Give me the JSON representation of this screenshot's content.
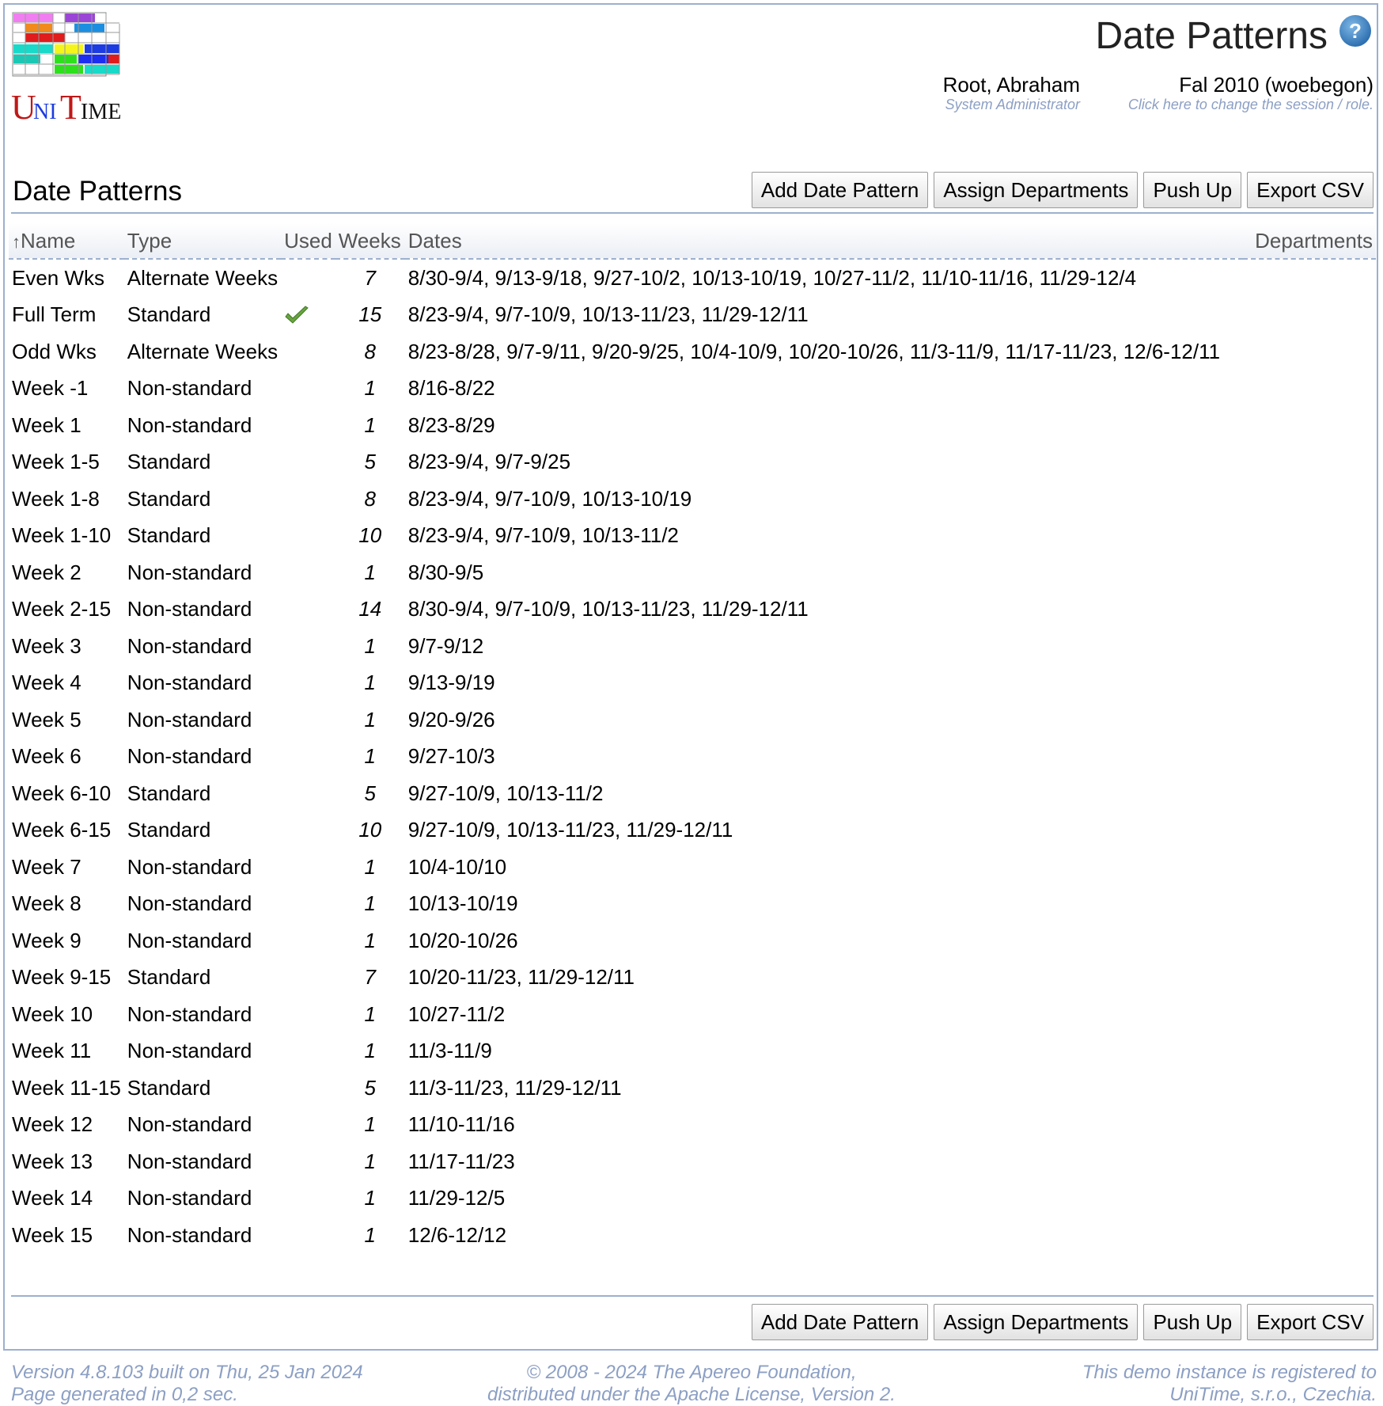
{
  "header": {
    "page_title": "Date Patterns",
    "user_name": "Root, Abraham",
    "user_role": "System Administrator",
    "session_name": "Fal 2010 (woebegon)",
    "session_hint": "Click here to change the session / role."
  },
  "logo": {
    "text_u": "U",
    "text_ni": "NI",
    "text_t": "T",
    "text_ime": "IME"
  },
  "section": {
    "title": "Date Patterns",
    "buttons": {
      "add": "Add Date Pattern",
      "assign": "Assign Departments",
      "push": "Push Up",
      "export": "Export CSV"
    }
  },
  "table": {
    "columns": {
      "sort_arrow": "↑",
      "name": "Name",
      "type": "Type",
      "used": "Used",
      "weeks": "Weeks",
      "dates": "Dates",
      "departments": "Departments"
    },
    "rows": [
      {
        "name": "Even Wks",
        "type": "Alternate Weeks",
        "used": false,
        "weeks": "7",
        "dates": "8/30-9/4, 9/13-9/18, 9/27-10/2, 10/13-10/19, 10/27-11/2, 11/10-11/16, 11/29-12/4",
        "departments": ""
      },
      {
        "name": "Full Term",
        "type": "Standard",
        "used": true,
        "weeks": "15",
        "dates": "8/23-9/4, 9/7-10/9, 10/13-11/23, 11/29-12/11",
        "departments": ""
      },
      {
        "name": "Odd Wks",
        "type": "Alternate Weeks",
        "used": false,
        "weeks": "8",
        "dates": "8/23-8/28, 9/7-9/11, 9/20-9/25, 10/4-10/9, 10/20-10/26, 11/3-11/9, 11/17-11/23, 12/6-12/11",
        "departments": ""
      },
      {
        "name": "Week -1",
        "type": "Non-standard",
        "used": false,
        "weeks": "1",
        "dates": "8/16-8/22",
        "departments": ""
      },
      {
        "name": "Week 1",
        "type": "Non-standard",
        "used": false,
        "weeks": "1",
        "dates": "8/23-8/29",
        "departments": ""
      },
      {
        "name": "Week 1-5",
        "type": "Standard",
        "used": false,
        "weeks": "5",
        "dates": "8/23-9/4, 9/7-9/25",
        "departments": ""
      },
      {
        "name": "Week 1-8",
        "type": "Standard",
        "used": false,
        "weeks": "8",
        "dates": "8/23-9/4, 9/7-10/9, 10/13-10/19",
        "departments": ""
      },
      {
        "name": "Week 1-10",
        "type": "Standard",
        "used": false,
        "weeks": "10",
        "dates": "8/23-9/4, 9/7-10/9, 10/13-11/2",
        "departments": ""
      },
      {
        "name": "Week 2",
        "type": "Non-standard",
        "used": false,
        "weeks": "1",
        "dates": "8/30-9/5",
        "departments": ""
      },
      {
        "name": "Week 2-15",
        "type": "Non-standard",
        "used": false,
        "weeks": "14",
        "dates": "8/30-9/4, 9/7-10/9, 10/13-11/23, 11/29-12/11",
        "departments": ""
      },
      {
        "name": "Week 3",
        "type": "Non-standard",
        "used": false,
        "weeks": "1",
        "dates": "9/7-9/12",
        "departments": ""
      },
      {
        "name": "Week 4",
        "type": "Non-standard",
        "used": false,
        "weeks": "1",
        "dates": "9/13-9/19",
        "departments": ""
      },
      {
        "name": "Week 5",
        "type": "Non-standard",
        "used": false,
        "weeks": "1",
        "dates": "9/20-9/26",
        "departments": ""
      },
      {
        "name": "Week 6",
        "type": "Non-standard",
        "used": false,
        "weeks": "1",
        "dates": "9/27-10/3",
        "departments": ""
      },
      {
        "name": "Week 6-10",
        "type": "Standard",
        "used": false,
        "weeks": "5",
        "dates": "9/27-10/9, 10/13-11/2",
        "departments": ""
      },
      {
        "name": "Week 6-15",
        "type": "Standard",
        "used": false,
        "weeks": "10",
        "dates": "9/27-10/9, 10/13-11/23, 11/29-12/11",
        "departments": ""
      },
      {
        "name": "Week 7",
        "type": "Non-standard",
        "used": false,
        "weeks": "1",
        "dates": "10/4-10/10",
        "departments": ""
      },
      {
        "name": "Week 8",
        "type": "Non-standard",
        "used": false,
        "weeks": "1",
        "dates": "10/13-10/19",
        "departments": ""
      },
      {
        "name": "Week 9",
        "type": "Non-standard",
        "used": false,
        "weeks": "1",
        "dates": "10/20-10/26",
        "departments": ""
      },
      {
        "name": "Week 9-15",
        "type": "Standard",
        "used": false,
        "weeks": "7",
        "dates": "10/20-11/23, 11/29-12/11",
        "departments": ""
      },
      {
        "name": "Week 10",
        "type": "Non-standard",
        "used": false,
        "weeks": "1",
        "dates": "10/27-11/2",
        "departments": ""
      },
      {
        "name": "Week 11",
        "type": "Non-standard",
        "used": false,
        "weeks": "1",
        "dates": "11/3-11/9",
        "departments": ""
      },
      {
        "name": "Week 11-15",
        "type": "Standard",
        "used": false,
        "weeks": "5",
        "dates": "11/3-11/23, 11/29-12/11",
        "departments": ""
      },
      {
        "name": "Week 12",
        "type": "Non-standard",
        "used": false,
        "weeks": "1",
        "dates": "11/10-11/16",
        "departments": ""
      },
      {
        "name": "Week 13",
        "type": "Non-standard",
        "used": false,
        "weeks": "1",
        "dates": "11/17-11/23",
        "departments": ""
      },
      {
        "name": "Week 14",
        "type": "Non-standard",
        "used": false,
        "weeks": "1",
        "dates": "11/29-12/5",
        "departments": ""
      },
      {
        "name": "Week 15",
        "type": "Non-standard",
        "used": false,
        "weeks": "1",
        "dates": "12/6-12/12",
        "departments": ""
      }
    ]
  },
  "footer": {
    "version": "Version 4.8.103 built on Thu, 25 Jan 2024",
    "generated": "Page generated in 0,2 sec.",
    "copyright": "© 2008 - 2024 The Apereo Foundation,",
    "license": "distributed under the Apache License, Version 2.",
    "registered": "This demo instance is registered to",
    "registrant": "UniTime, s.r.o., Czechia."
  },
  "icons": {
    "help": "help-icon",
    "used": "checkmark-icon"
  },
  "colors": {
    "accent": "#9cb0ce",
    "sub_text": "#8c9fc4",
    "check": "#6aa341"
  }
}
